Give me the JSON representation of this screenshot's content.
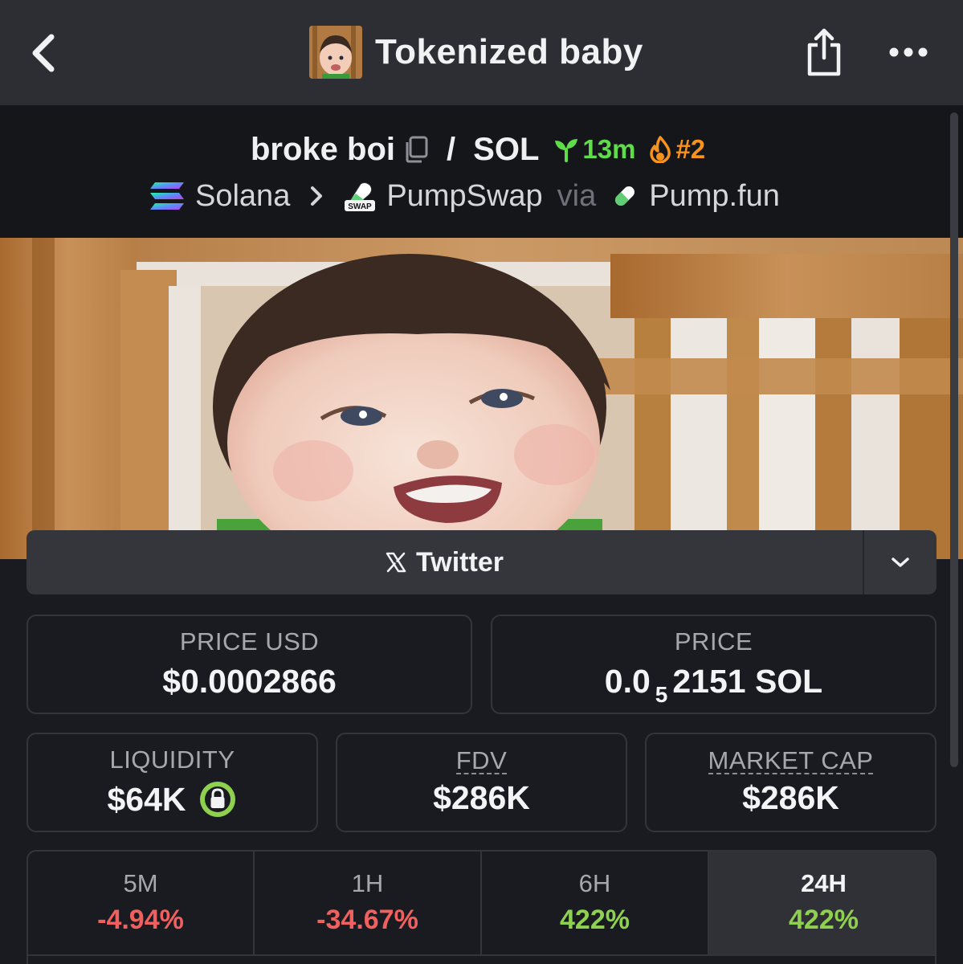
{
  "nav": {
    "title": "Tokenized baby"
  },
  "pair": {
    "base": "broke boi",
    "separator": "/",
    "quote": "SOL",
    "age": "13m",
    "rank": "#2",
    "chain": "Solana",
    "dex": "PumpSwap",
    "via": "via",
    "launchpad": "Pump.fun",
    "dex_icon_text": "SWAP"
  },
  "links": {
    "twitter_label": "Twitter"
  },
  "stats": {
    "price_usd_label": "PRICE USD",
    "price_usd_value": "$0.0002866",
    "price_label": "PRICE",
    "price_prefix": "0.0",
    "price_zero_count": "5",
    "price_suffix": "2151 SOL",
    "liquidity_label": "LIQUIDITY",
    "liquidity_value": "$64K",
    "fdv_label": "FDV",
    "fdv_value": "$286K",
    "mcap_label": "MARKET CAP",
    "mcap_value": "$286K"
  },
  "changes": [
    {
      "label": "5M",
      "value": "-4.94%",
      "trend": "negative"
    },
    {
      "label": "1H",
      "value": "-34.67%",
      "trend": "negative"
    },
    {
      "label": "6H",
      "value": "422%",
      "trend": "positive"
    },
    {
      "label": "24H",
      "value": "422%",
      "trend": "positive",
      "selected": true
    }
  ],
  "colors": {
    "positive": "#8fd14f",
    "negative": "#f0605f",
    "age_green": "#5fdc4a",
    "rank_orange": "#f7931a"
  },
  "icons": {
    "back": "chevron-left-icon",
    "share": "share-icon",
    "more": "more-icon",
    "copy": "copy-icon",
    "age": "seedling-icon",
    "rank": "flame-icon",
    "chain": "solana-icon",
    "dex": "pumpswap-icon",
    "launchpad": "pill-icon",
    "twitter": "x-logo-icon",
    "dropdown": "chevron-down-icon",
    "lock": "lock-icon"
  }
}
